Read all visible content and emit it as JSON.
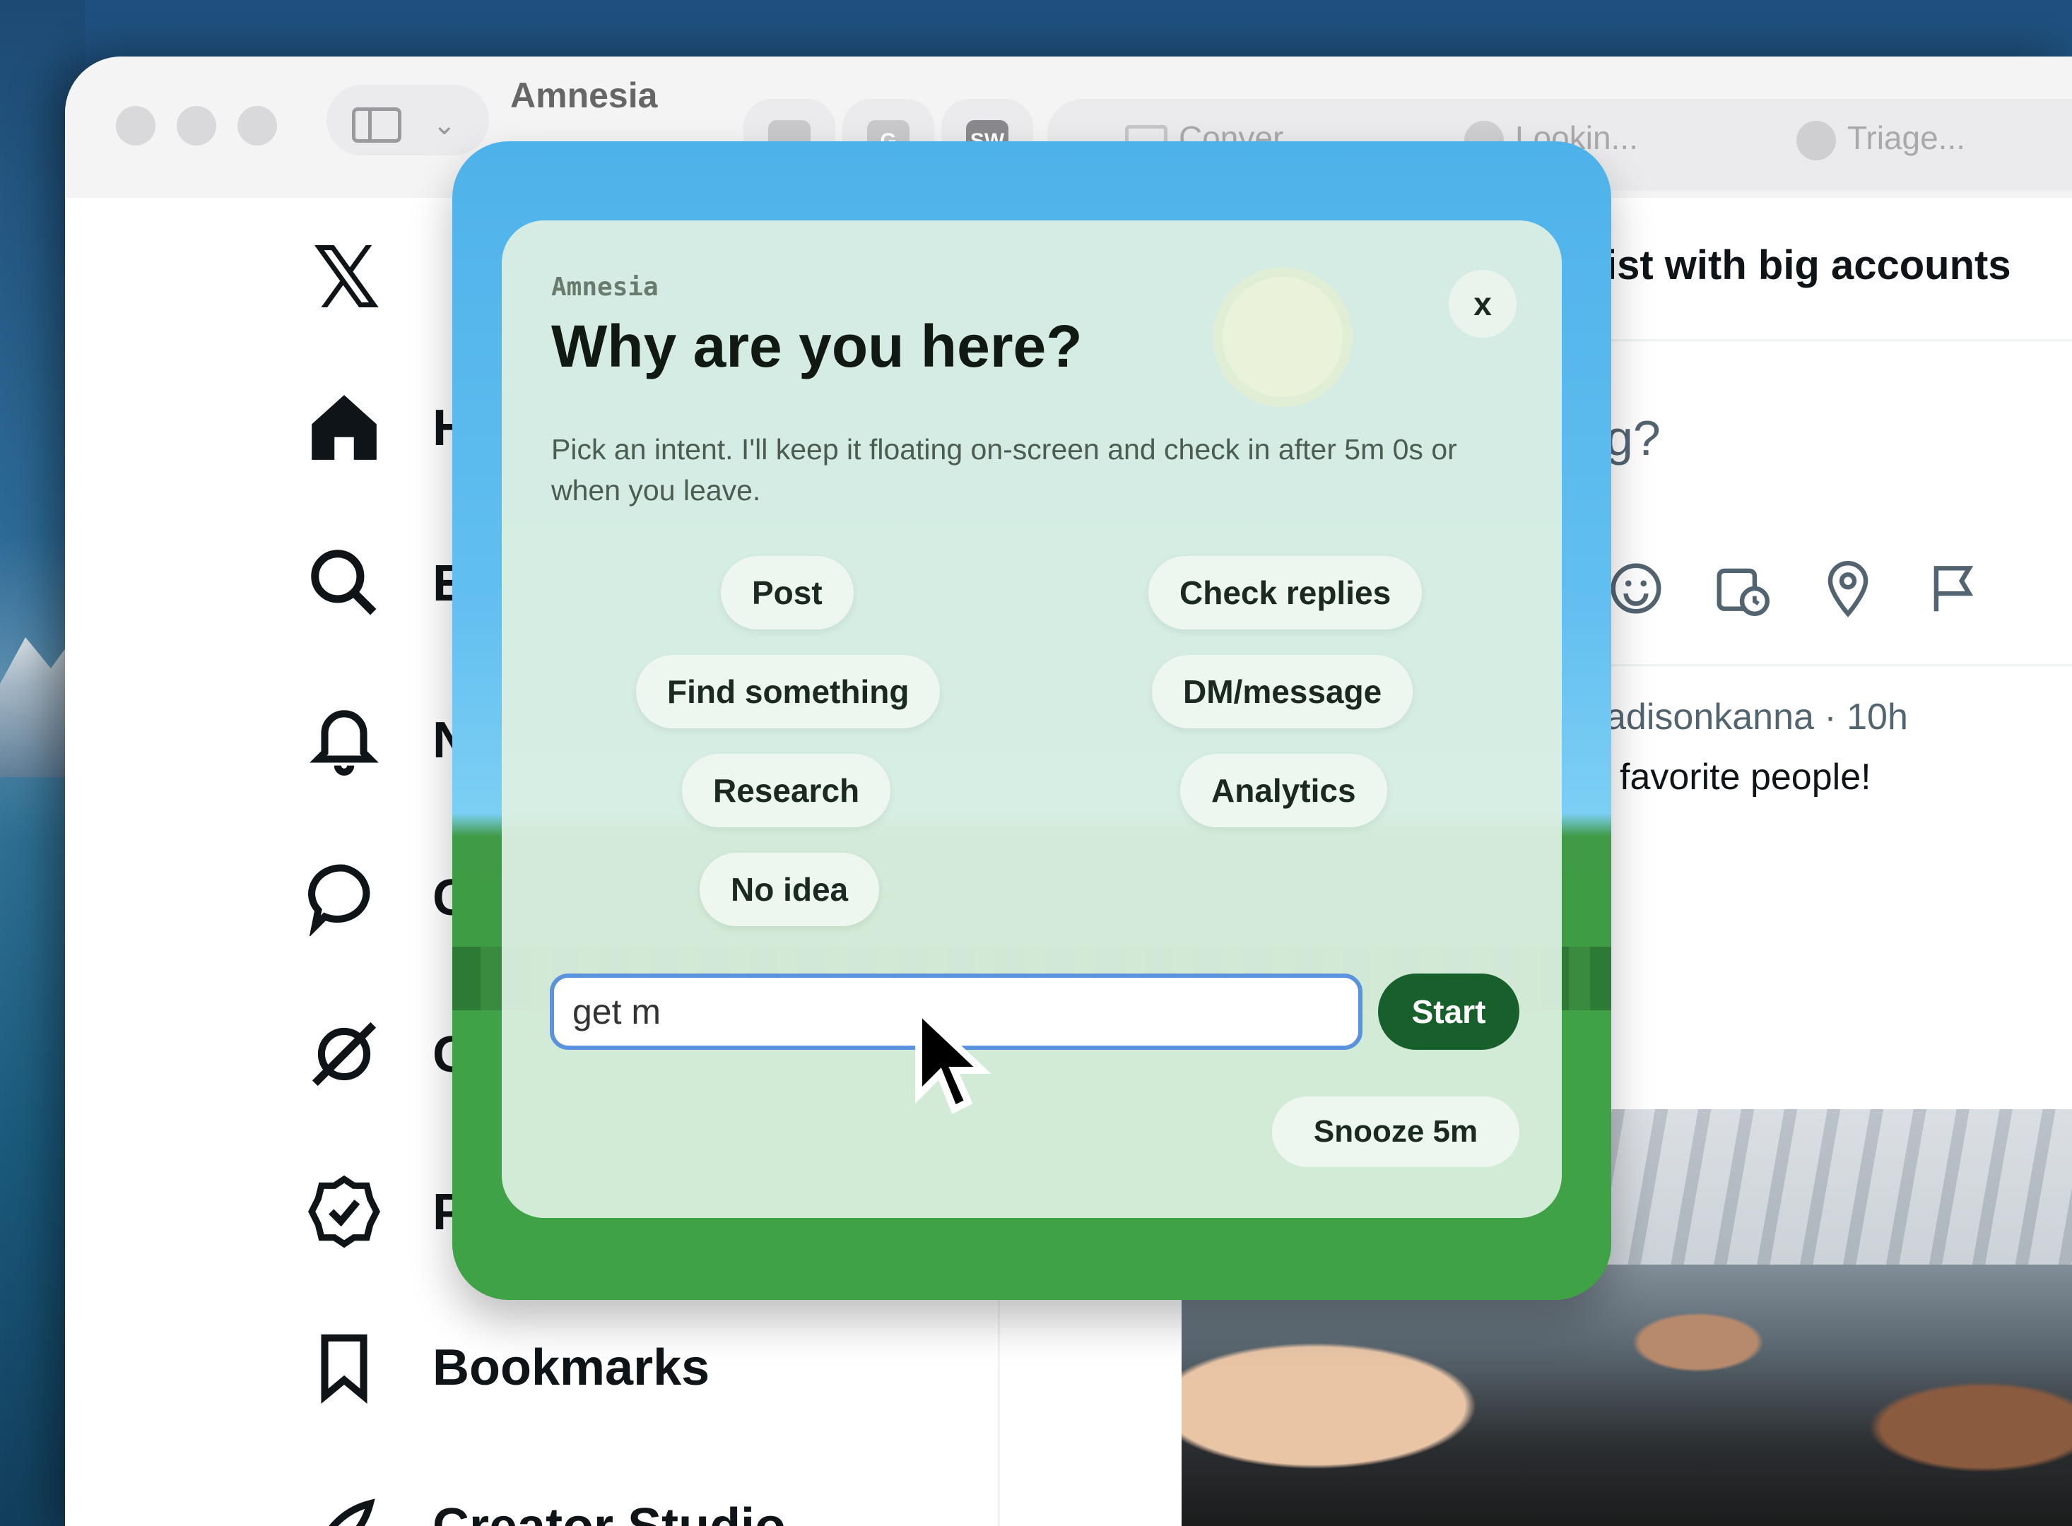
{
  "browser": {
    "app_title": "Amnesia",
    "tabs": [
      {
        "label": "Conver...",
        "icon": "gmail-icon"
      },
      {
        "label": "Lookin...",
        "icon": "assistant-icon"
      },
      {
        "label": "Triage...",
        "icon": "openai-icon"
      }
    ],
    "pinned": [
      "apple-icon",
      "g-icon",
      "sw-icon"
    ],
    "pinned_text": {
      "g": "G",
      "sw": "SW"
    }
  },
  "x_sidebar": {
    "logo": "𝕏",
    "items": [
      {
        "label": "H",
        "icon": "home-icon"
      },
      {
        "label": "E",
        "icon": "search-icon"
      },
      {
        "label": "N",
        "icon": "bell-icon"
      },
      {
        "label": "C",
        "icon": "chat-icon"
      },
      {
        "label": "G",
        "icon": "grok-icon"
      },
      {
        "label": "P",
        "icon": "verified-icon"
      },
      {
        "label": "Bookmarks",
        "icon": "bookmark-icon"
      },
      {
        "label": "Creator Studio",
        "icon": "rocket-icon"
      }
    ]
  },
  "timeline": {
    "header": "ist with big accounts",
    "compose_hint": "g?",
    "post_meta": "adisonkanna · 10h",
    "post_text": "favorite people!"
  },
  "popup": {
    "brand": "Amnesia",
    "title": "Why are you here?",
    "description": "Pick an intent. I'll keep it floating on-screen and check in after 5m 0s or when you leave.",
    "close_label": "x",
    "intents": [
      "Post",
      "Check replies",
      "Find something",
      "DM/message",
      "Research",
      "Analytics",
      "No idea"
    ],
    "input_value": "get m",
    "start_label": "Start",
    "snooze_label": "Snooze 5m"
  },
  "colors": {
    "accent_green": "#17602b",
    "input_border": "#5a92de",
    "sky": "#4eb2ea",
    "grass": "#40a246"
  }
}
